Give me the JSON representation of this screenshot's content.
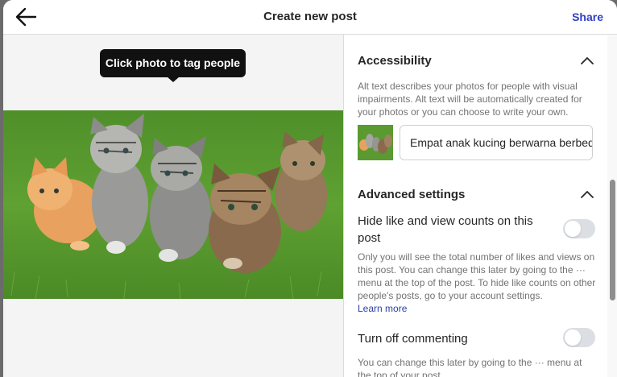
{
  "header": {
    "title": "Create new post",
    "share_label": "Share"
  },
  "tooltip": {
    "text": "Click photo to tag people"
  },
  "photo": {
    "alt": "Empat anak kucing berwarna berbeda duduk di atas rumput"
  },
  "accessibility": {
    "title": "Accessibility",
    "description": "Alt text describes your photos for people with visual impairments. Alt text will be automatically created for your photos or you can choose to write your own.",
    "alt_value": "Empat anak kucing berwarna berbeda"
  },
  "advanced": {
    "title": "Advanced settings",
    "hide_counts_label": "Hide like and view counts on this post",
    "hide_counts_desc": "Only you will see the total number of likes and views on this post. You can change this later by going to the ··· menu at the top of the post. To hide like counts on other people's posts, go to your account settings.",
    "learn_more": "Learn more",
    "hide_counts_on": false,
    "commenting_label": "Turn off commenting",
    "commenting_desc": "You can change this later by going to the ··· menu at the top of your post.",
    "commenting_off": false
  },
  "colors": {
    "accent": "#3040c0",
    "link": "#2b3fa8",
    "toggle_off": "#dbdfe4"
  }
}
